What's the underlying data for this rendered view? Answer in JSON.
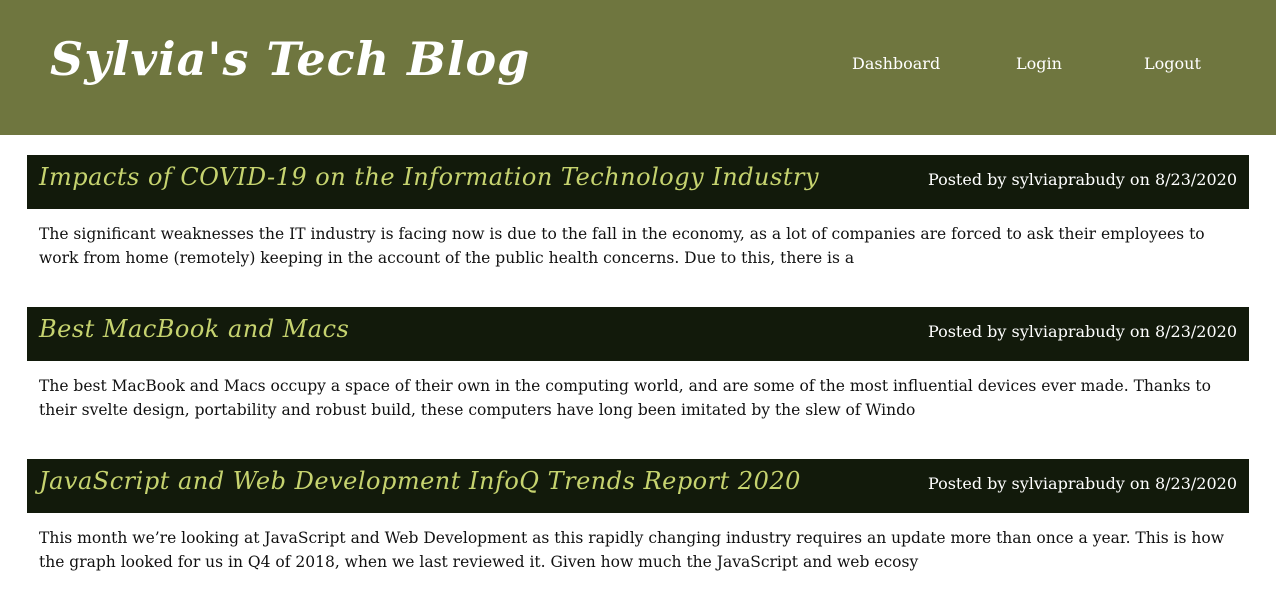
{
  "header": {
    "site_title": "Sylvia's Tech Blog",
    "nav": {
      "dashboard": "Dashboard",
      "login": "Login",
      "logout": "Logout"
    }
  },
  "posts": [
    {
      "title": "Impacts of COVID-19 on the Information Technology Industry",
      "meta": "Posted by sylviaprabudy on 8/23/2020",
      "excerpt": "The significant weaknesses the IT industry is facing now is due to the fall in the economy, as a lot of companies are forced to ask their employees to work from home (remotely) keeping in the account of the public health concerns. Due to this, there is a"
    },
    {
      "title": "Best MacBook and Macs",
      "meta": "Posted by sylviaprabudy on 8/23/2020",
      "excerpt": "The best MacBook and Macs occupy a space of their own in the computing world, and are some of the most influential devices ever made. Thanks to their svelte design, portability and robust build, these computers have long been imitated by the slew of Windo"
    },
    {
      "title": "JavaScript and Web Development InfoQ Trends Report 2020",
      "meta": "Posted by sylviaprabudy on 8/23/2020",
      "excerpt": "This month we’re looking at JavaScript and Web Development as this rapidly changing industry requires an update more than once a year. This is how the graph looked for us in Q4 of 2018, when we last reviewed it. Given how much the JavaScript and web ecosy"
    }
  ],
  "colors": {
    "header_bg": "#6f763f",
    "post_header_bg": "#121a0b",
    "post_title": "#c6d36f"
  }
}
